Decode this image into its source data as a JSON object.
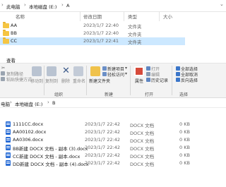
{
  "top": {
    "breadcrumb": [
      "此电脑",
      "本地磁盘 (E:)",
      "A"
    ],
    "columns": {
      "name": "名称",
      "date": "修改日期",
      "type": "类型",
      "size": "大小"
    },
    "rows": [
      {
        "name": "AA",
        "date": "2023/1/7 22:40",
        "type": "文件夹"
      },
      {
        "name": "BB",
        "date": "2023/1/7 22:40",
        "type": "文件夹"
      },
      {
        "name": "CC",
        "date": "2023/1/7 22:41",
        "type": "文件夹",
        "selected": true
      }
    ]
  },
  "ribbon": {
    "tab": "查看",
    "clipboard": {
      "copy_path": "复制路径",
      "paste_shortcut": "粘贴快捷方式"
    },
    "organize": {
      "move_to": "移动到",
      "copy_to": "复制到",
      "delete": "删除",
      "rename": "重命名",
      "group": "组织"
    },
    "new": {
      "new_folder": "新建文件夹",
      "new_item": "新建项目",
      "easy_access": "轻松访问",
      "group": "新建"
    },
    "open": {
      "properties": "属性",
      "open": "打开",
      "edit": "编辑",
      "history": "历史记录",
      "group": "打开"
    },
    "select": {
      "select_all": "全部选择",
      "select_none": "全部取消",
      "invert": "反向选择",
      "group": "选择"
    }
  },
  "bottom": {
    "breadcrumb": [
      "电脑",
      "本地磁盘 (E:)",
      "B"
    ],
    "rows": [
      {
        "name": "1111CC.docx",
        "date": "2023/1/7 22:42",
        "type": "DOCX 文档",
        "size": "0 KB"
      },
      {
        "name": "AA00102.docx",
        "date": "2023/1/7 22:42",
        "type": "DOCX 文档",
        "size": "0 KB"
      },
      {
        "name": "AA0306.docx",
        "date": "2023/1/7 22:42",
        "type": "DOCX 文档",
        "size": "0 KB"
      },
      {
        "name": "BB新建 DOCX 文档 - 副本 (3).docx",
        "date": "2023/1/7 22:42",
        "type": "DOCX 文档",
        "size": "0 KB"
      },
      {
        "name": "CC新建 DOCX 文档 - 副本.docx",
        "date": "2023/1/7 22:42",
        "type": "DOCX 文档",
        "size": "0 KB"
      },
      {
        "name": "DD新建 DOCX 文档 - 副本 (4).docx",
        "date": "2023/1/7 22:42",
        "type": "DOCX 文档",
        "size": "0 KB"
      }
    ]
  }
}
